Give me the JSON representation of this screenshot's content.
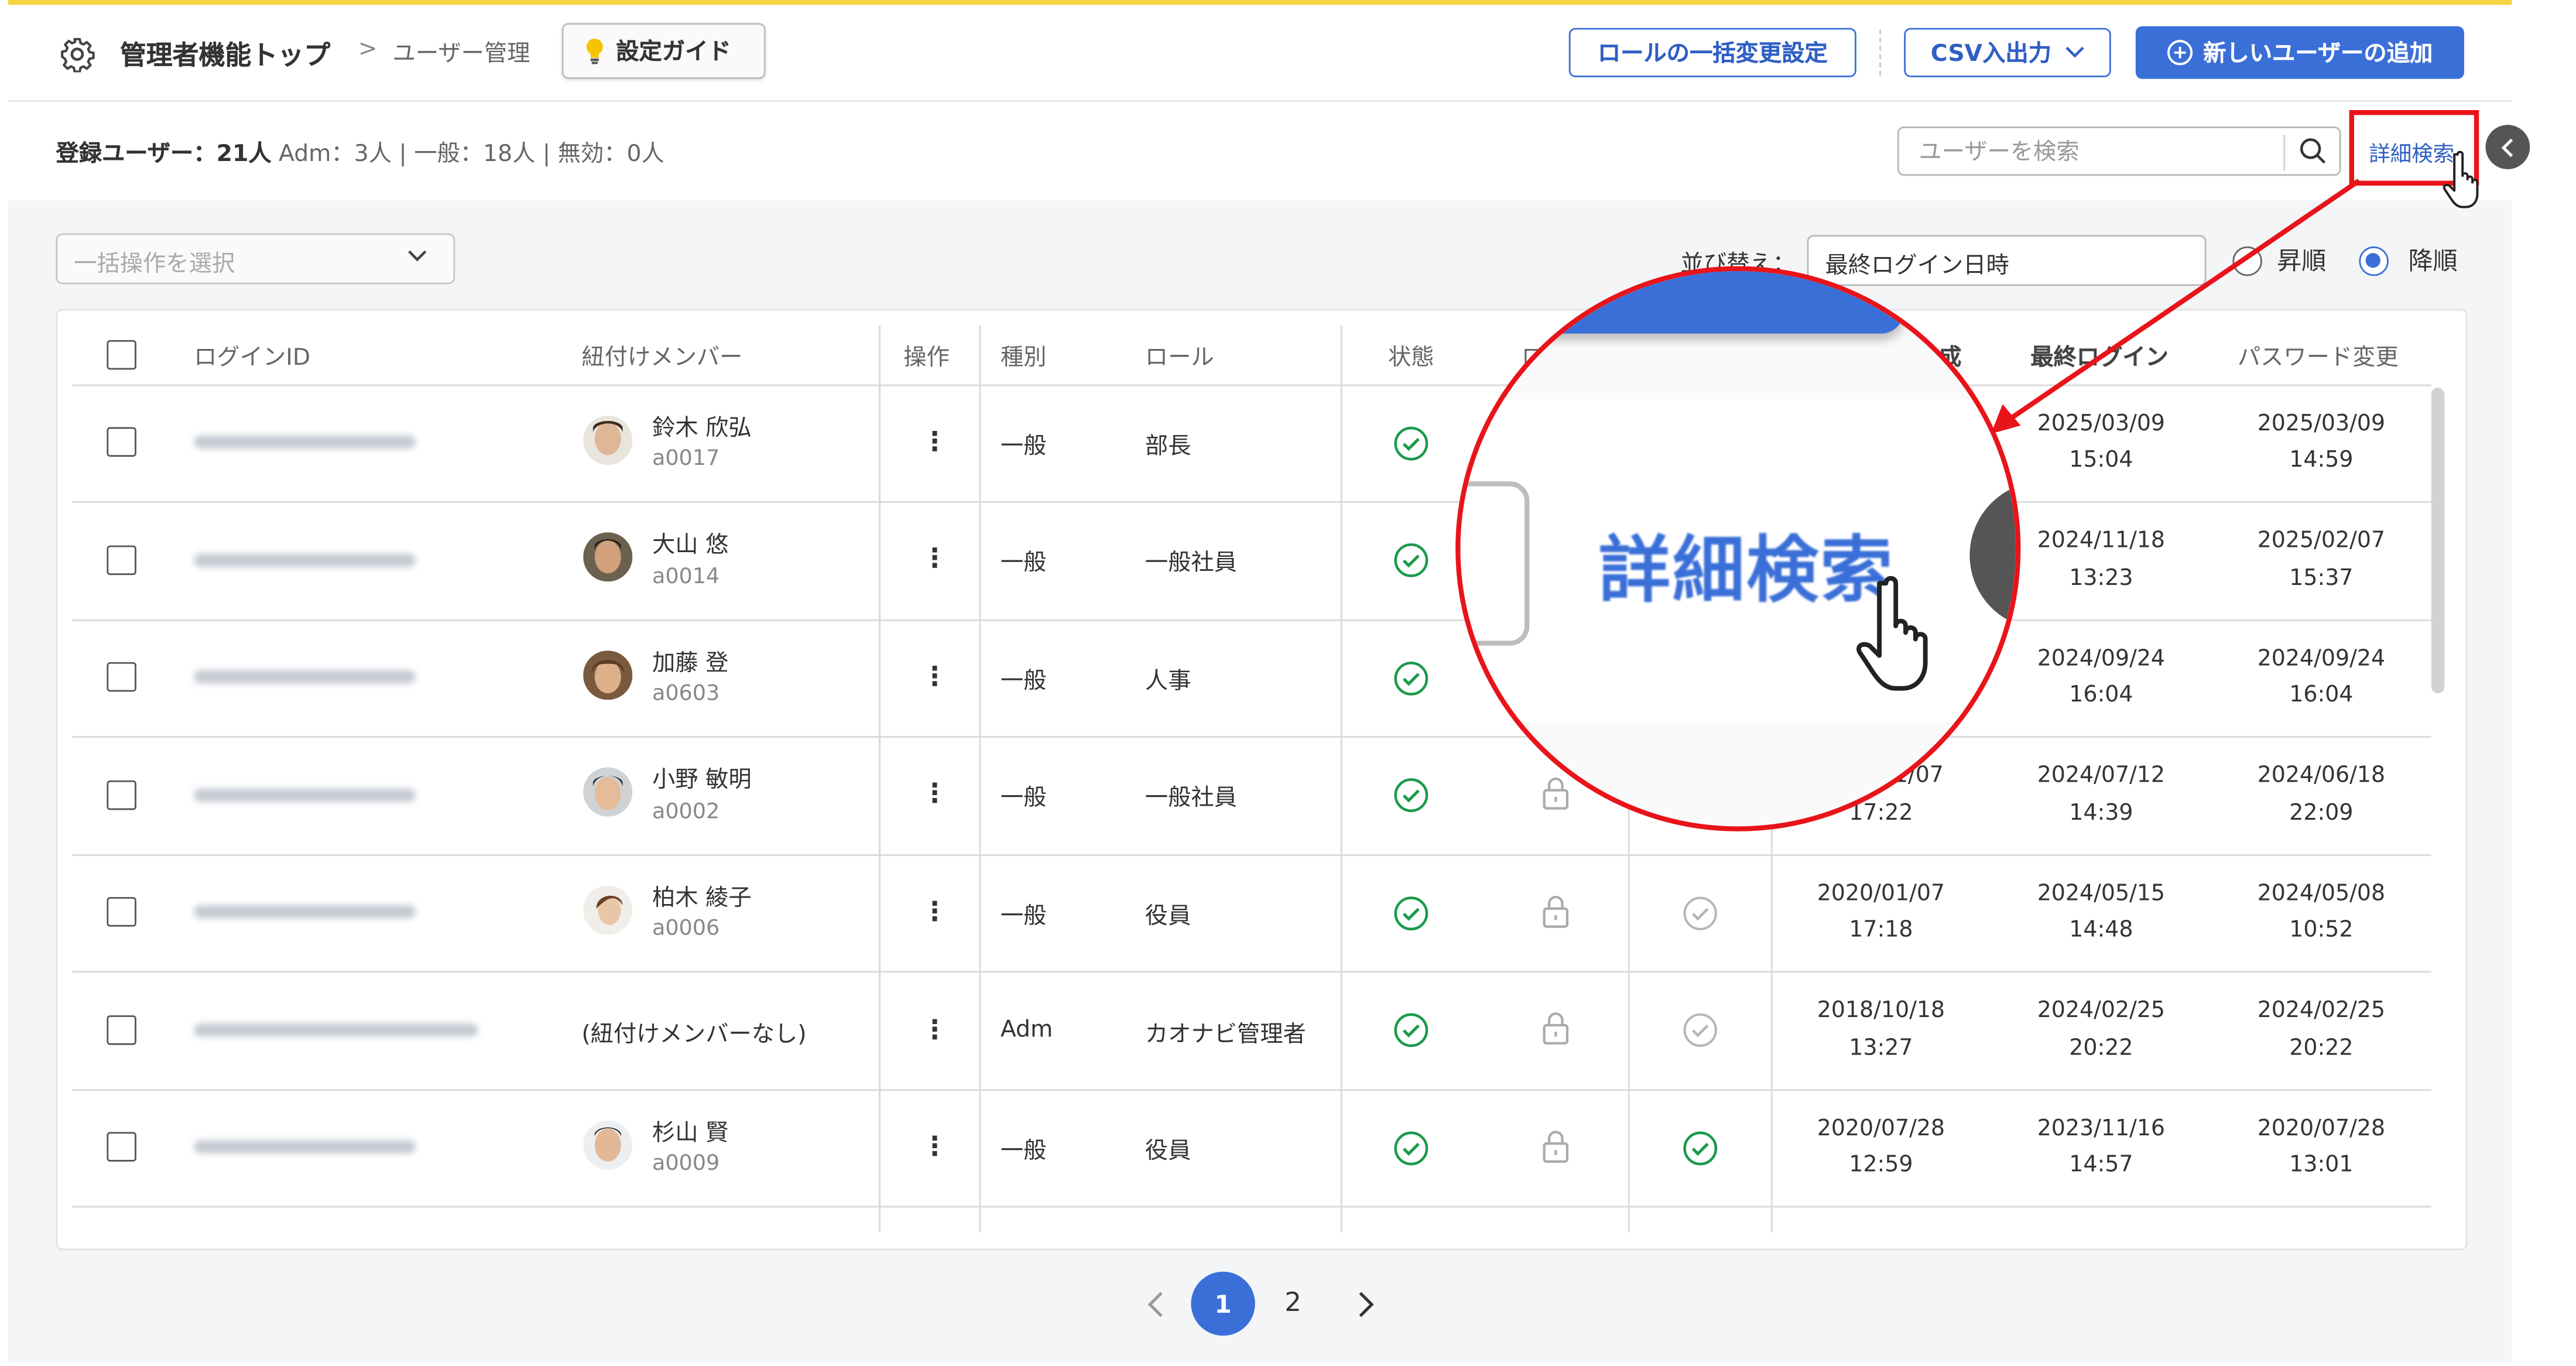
{
  "header": {
    "breadcrumb_top": "管理者機能トップ",
    "breadcrumb_sep": ">",
    "breadcrumb_current": "ユーザー管理",
    "guide_button": "設定ガイド",
    "role_bulk_button": "ロールの一括変更設定",
    "csv_button": "CSV入出力",
    "add_user_button": "新しいユーザーの追加"
  },
  "stats": {
    "label": "登録ユーザー：21人",
    "adm": "Adm：3人",
    "general": "一般：18人",
    "invalid": "無効：0人",
    "divider": "|"
  },
  "search": {
    "placeholder": "ユーザーを検索",
    "advanced": "詳細検索"
  },
  "toolbar": {
    "bulk_placeholder": "一括操作を選択",
    "sort_label": "並び替え：",
    "sort_value": "最終ログイン日時",
    "asc_label": "昇順",
    "desc_label": "降順",
    "sort_order": "desc"
  },
  "table": {
    "columns": [
      "ログインID",
      "紐付けメンバー",
      "操作",
      "種別",
      "ロール",
      "状態",
      "ロ",
      "成",
      "最終ログイン",
      "パスワード変更"
    ],
    "rows": [
      {
        "name": "鈴木 欣弘",
        "code": "a0017",
        "type": "一般",
        "role": "部長",
        "created": [
          "",
          ""
        ],
        "last_login": [
          "2025/03/09",
          "15:04"
        ],
        "pw_change": [
          "2025/03/09",
          "14:59"
        ]
      },
      {
        "name": "大山 悠",
        "code": "a0014",
        "type": "一般",
        "role": "一般社員",
        "created": [
          "",
          ""
        ],
        "last_login": [
          "2024/11/18",
          "13:23"
        ],
        "pw_change": [
          "2025/02/07",
          "15:37"
        ]
      },
      {
        "name": "加藤 登",
        "code": "a0603",
        "type": "一般",
        "role": "人事",
        "created": [
          "",
          ""
        ],
        "last_login": [
          "2024/09/24",
          "16:04"
        ],
        "pw_change": [
          "2024/09/24",
          "16:04"
        ]
      },
      {
        "name": "小野 敏明",
        "code": "a0002",
        "type": "一般",
        "role": "一般社員",
        "created": [
          "1/07",
          "17:22"
        ],
        "last_login": [
          "2024/07/12",
          "14:39"
        ],
        "pw_change": [
          "2024/06/18",
          "22:09"
        ]
      },
      {
        "name": "柏木 綾子",
        "code": "a0006",
        "type": "一般",
        "role": "役員",
        "created": [
          "2020/01/07",
          "17:18"
        ],
        "last_login": [
          "2024/05/15",
          "14:48"
        ],
        "pw_change": [
          "2024/05/08",
          "10:52"
        ]
      },
      {
        "name": "(紐付けメンバーなし)",
        "code": "",
        "type": "Adm",
        "role": "カオナビ管理者",
        "created": [
          "2018/10/18",
          "13:27"
        ],
        "last_login": [
          "2024/02/25",
          "20:22"
        ],
        "pw_change": [
          "2024/02/25",
          "20:22"
        ]
      },
      {
        "name": "杉山 賢",
        "code": "a0009",
        "type": "一般",
        "role": "役員",
        "created": [
          "2020/07/28",
          "12:59"
        ],
        "last_login": [
          "2023/11/16",
          "14:57"
        ],
        "pw_change": [
          "2020/07/28",
          "13:01"
        ]
      }
    ],
    "row_action_glyph": "⋮"
  },
  "pagination": {
    "current": "1",
    "next_page": "2"
  },
  "zoom": {
    "label": "詳細検索"
  },
  "colors": {
    "accent": "#3a6fd8",
    "highlight": "#e8141a",
    "ok_green": "#1a9a4a",
    "top_stripe": "#f5d442"
  }
}
